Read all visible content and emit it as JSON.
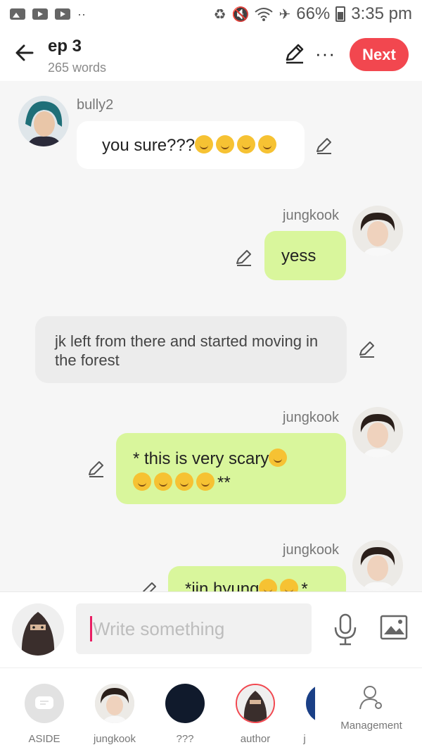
{
  "status_bar": {
    "battery": "66%",
    "time": "3:35 pm",
    "dots": "··"
  },
  "header": {
    "title": "ep 3",
    "word_count": "265 words",
    "next_label": "Next",
    "more_label": "···"
  },
  "chat": {
    "messages": [
      {
        "speaker": "bully2",
        "text": "you sure???",
        "side": "left",
        "emojis": 4
      },
      {
        "speaker": "jungkook",
        "text": "yess",
        "side": "right"
      },
      {
        "speaker": "",
        "text": "jk left from there and started moving in the forest",
        "side": "narration"
      },
      {
        "speaker": "jungkook",
        "text_line1": "* this is very scary",
        "text_line2": "**",
        "side": "right",
        "emojis_line1": 1,
        "emojis_line2": 4
      },
      {
        "speaker": "jungkook",
        "text": "*jin hyung",
        "text_after": "*",
        "side": "right",
        "partial": true
      }
    ]
  },
  "input": {
    "placeholder": "Write something"
  },
  "roster": {
    "characters": [
      {
        "label": "ASIDE",
        "icon": "chat-icon"
      },
      {
        "label": "jungkook",
        "icon": "avatar"
      },
      {
        "label": "???",
        "icon": "avatar"
      },
      {
        "label": "author",
        "icon": "avatar",
        "selected": true
      },
      {
        "label": "j",
        "icon": "avatar"
      }
    ],
    "management_label": "Management"
  },
  "colors": {
    "accent": "#f2474f",
    "green_bubble": "#d9f69c",
    "white_bubble": "#ffffff",
    "narration_bubble": "#ececec"
  }
}
